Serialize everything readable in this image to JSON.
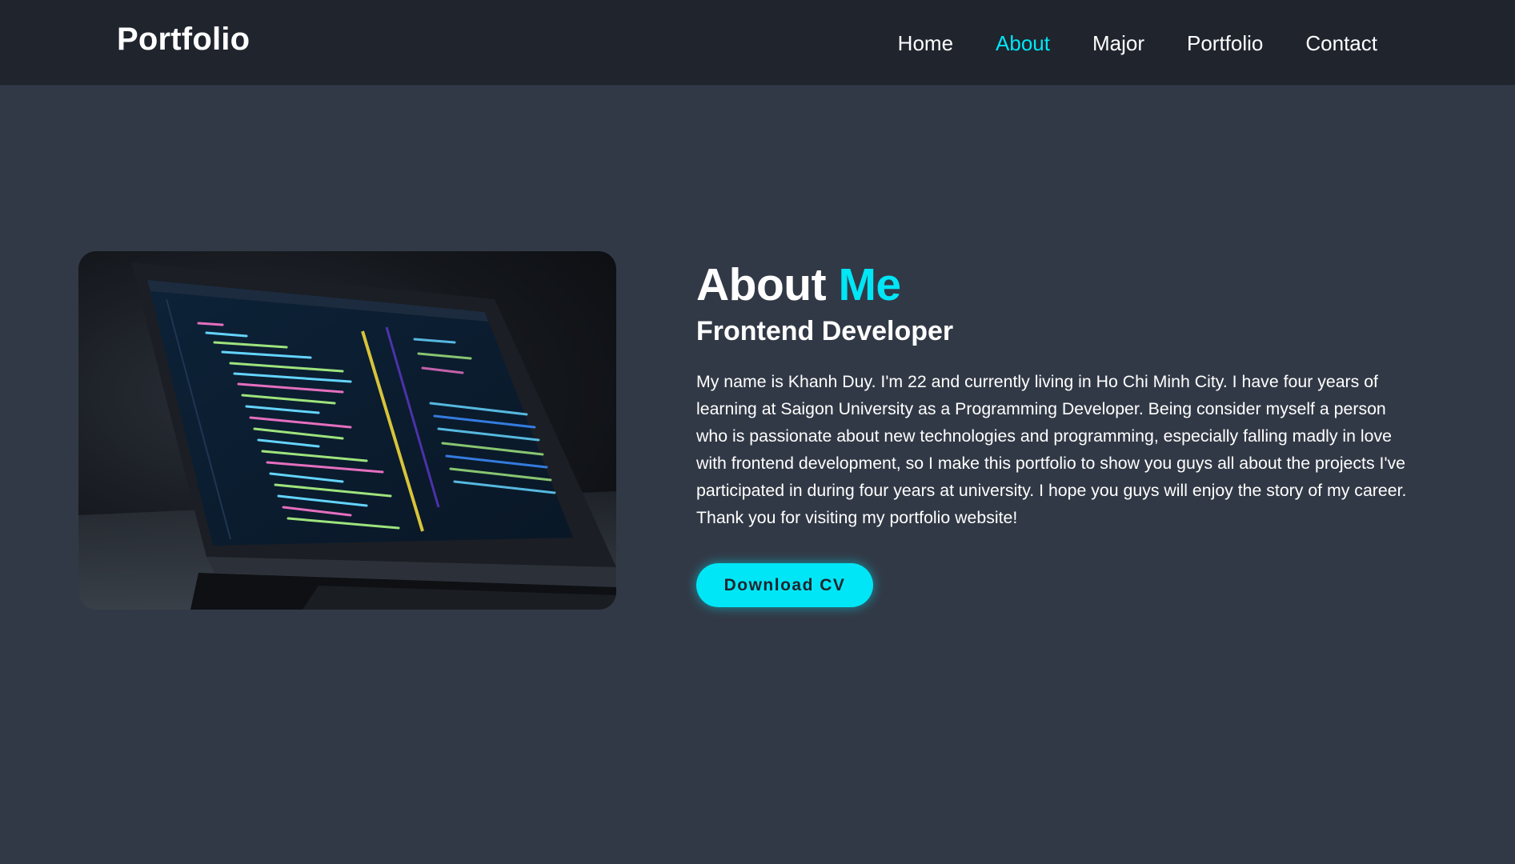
{
  "header": {
    "logo": "Portfolio",
    "nav": [
      {
        "label": "Home",
        "active": false
      },
      {
        "label": "About",
        "active": true
      },
      {
        "label": "Major",
        "active": false
      },
      {
        "label": "Portfolio",
        "active": false
      },
      {
        "label": "Contact",
        "active": false
      }
    ]
  },
  "about": {
    "image": "laptop-with-code-photo",
    "heading_main": "About",
    "heading_accent": "Me",
    "subheading": "Frontend Developer",
    "description": "My name is Khanh Duy. I'm 22 and currently living in Ho Chi Minh City. I have four years of learning at Saigon University as a Programming Developer. Being consider myself a person who is passionate about new technologies and programming, especially falling madly in love with frontend development, so I make this portfolio to show you guys all about the projects I've participated in during four years at university. I hope you guys will enjoy the story of my career. Thank you for visiting my portfolio website!",
    "button_label": "Download CV"
  },
  "colors": {
    "background": "#323946",
    "header_background": "#1f242d",
    "accent": "#00e6f6",
    "text": "#ffffff"
  }
}
